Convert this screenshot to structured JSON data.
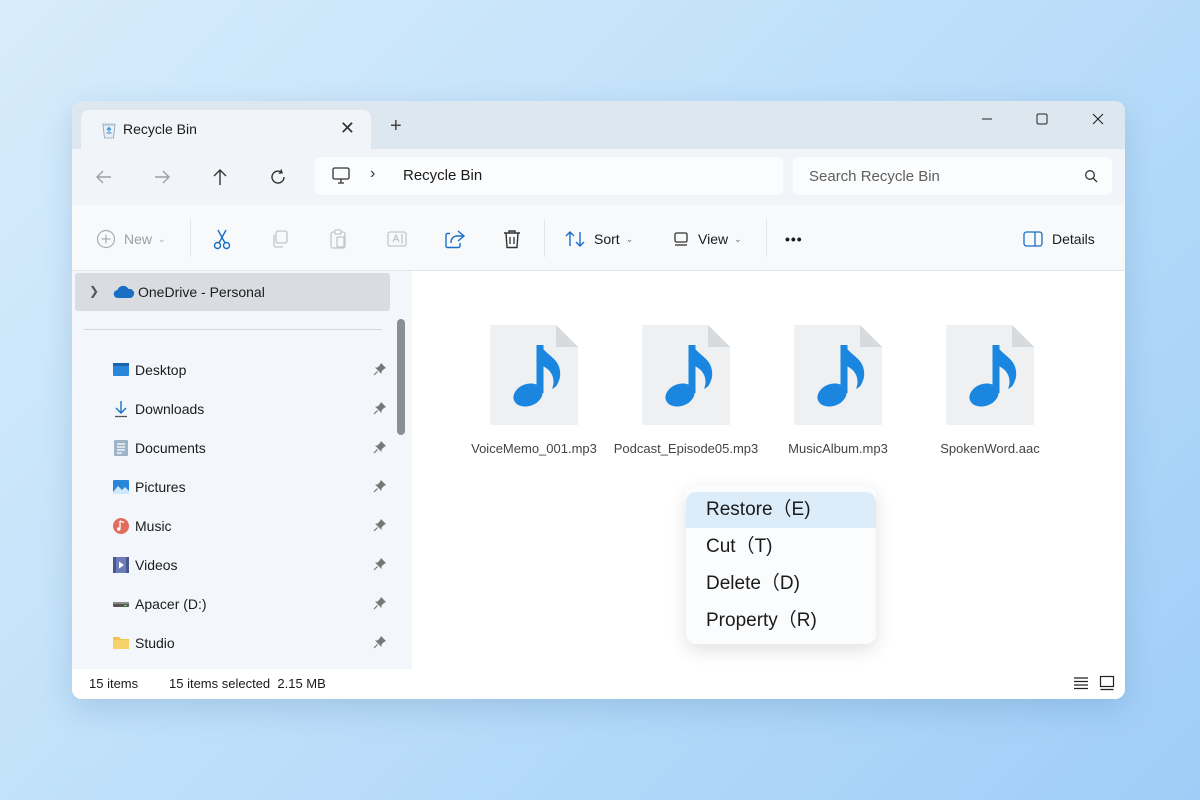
{
  "window": {
    "tab_title": "Recycle Bin",
    "new_tab_symbol": "+",
    "close_tab_symbol": "✕"
  },
  "nav": {
    "address_separator": "›",
    "address": "Recycle Bin",
    "search_placeholder": "Search Recycle Bin"
  },
  "toolbar": {
    "new_label": "New",
    "sort_label": "Sort",
    "view_label": "View",
    "more_label": "•••",
    "details_label": "Details",
    "caret": "⌄"
  },
  "sidebar": {
    "onedrive_label": "OneDrive - Personal",
    "items": [
      {
        "label": "Desktop",
        "icon": "desktop-icon"
      },
      {
        "label": "Downloads",
        "icon": "downloads-icon"
      },
      {
        "label": "Documents",
        "icon": "documents-icon"
      },
      {
        "label": "Pictures",
        "icon": "pictures-icon"
      },
      {
        "label": "Music",
        "icon": "music-icon"
      },
      {
        "label": "Videos",
        "icon": "videos-icon"
      },
      {
        "label": "Apacer (D:)",
        "icon": "drive-icon"
      },
      {
        "label": "Studio",
        "icon": "folder-icon"
      }
    ]
  },
  "files": [
    {
      "name": "VoiceMemo_001.mp3"
    },
    {
      "name": "Podcast_Episode05.mp3"
    },
    {
      "name": "MusicAlbum.mp3"
    },
    {
      "name": "SpokenWord.aac"
    }
  ],
  "context_menu": {
    "items": [
      "Restore（E)",
      "Cut（T)",
      "Delete（D)",
      "Property（R)"
    ]
  },
  "status": {
    "item_count": "15 items",
    "selection": "15 items selected  2.15 MB"
  },
  "colors": {
    "accent": "#0f6cbd",
    "music_note": "#1a86e0",
    "menu_highlight": "#dcecf9"
  }
}
